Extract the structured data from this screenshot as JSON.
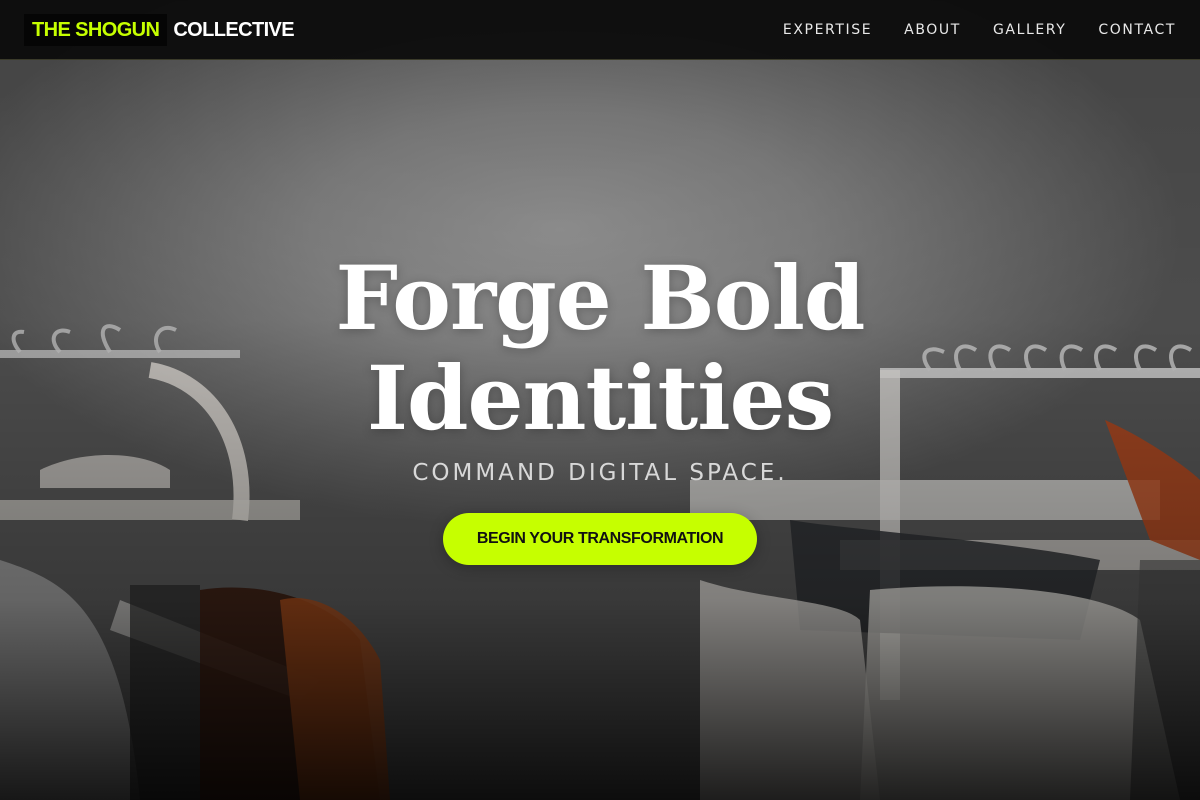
{
  "brand": {
    "accent": "THE SHOGUN",
    "main": "COLLECTIVE",
    "accent_color": "#c6ff00"
  },
  "nav": {
    "items": [
      {
        "label": "EXPERTISE"
      },
      {
        "label": "ABOUT"
      },
      {
        "label": "GALLERY"
      },
      {
        "label": "CONTACT"
      }
    ]
  },
  "hero": {
    "title_line1": "Forge Bold",
    "title_line2": "Identities",
    "subtitle": "COMMAND DIGITAL SPACE.",
    "cta_label": "BEGIN YOUR TRANSFORMATION",
    "background_image": "clothing-rack-hangers-photo"
  },
  "colors": {
    "cta_bg": "#c6ff00",
    "nav_bg": "#0c0c0c"
  }
}
